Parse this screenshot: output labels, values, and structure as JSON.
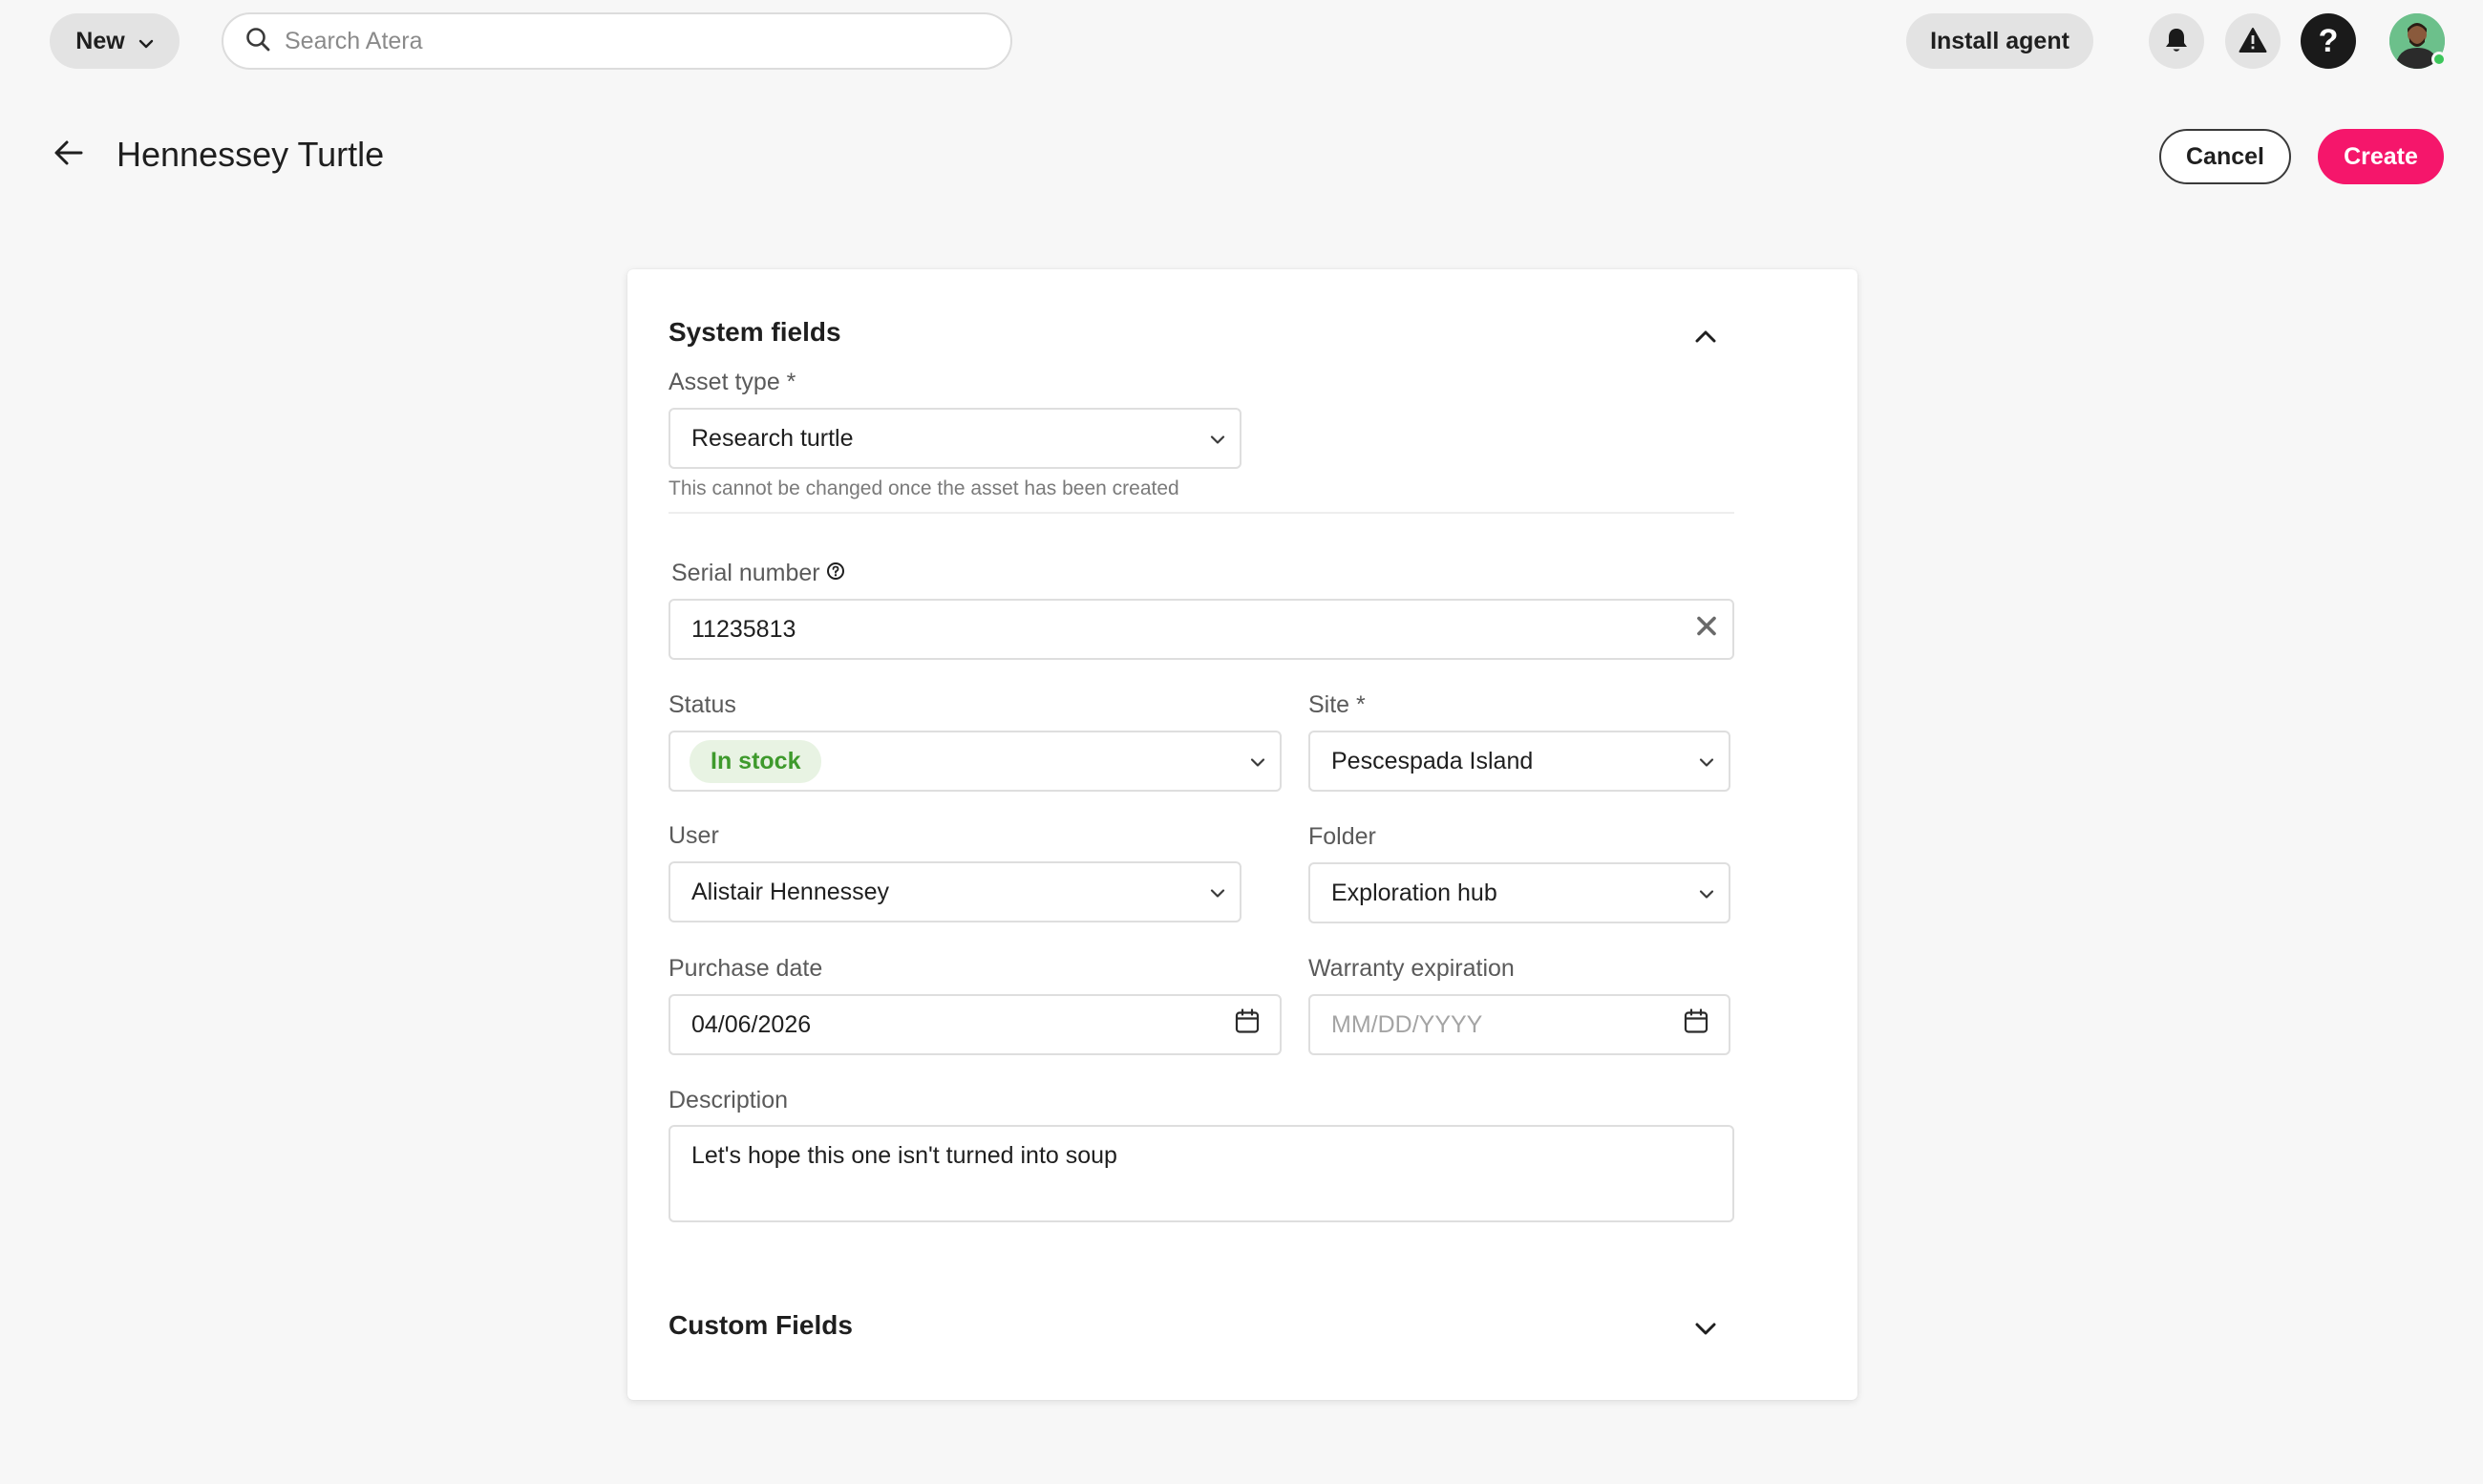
{
  "topbar": {
    "new_label": "New",
    "search_placeholder": "Search Atera",
    "install_agent_label": "Install agent",
    "help_label": "?"
  },
  "header": {
    "title": "Hennessey Turtle",
    "cancel_label": "Cancel",
    "create_label": "Create"
  },
  "colors": {
    "accent": "#f5166b",
    "status_green": "#3e9a2c",
    "status_bg": "#e8f3e3"
  },
  "system_fields": {
    "title": "System fields",
    "asset_type": {
      "label": "Asset type *",
      "value": "Research turtle",
      "hint": "This cannot be changed once the asset has been created"
    },
    "serial_number": {
      "label": "Serial number",
      "value": "11235813"
    },
    "status": {
      "label": "Status",
      "value": "In stock"
    },
    "site": {
      "label": "Site *",
      "value": "Pescespada Island"
    },
    "user": {
      "label": "User",
      "value": "Alistair Hennessey"
    },
    "folder": {
      "label": "Folder",
      "value": "Exploration hub"
    },
    "purchase_date": {
      "label": "Purchase date",
      "value": "04/06/2026"
    },
    "warranty_expiration": {
      "label": "Warranty expiration",
      "placeholder": "MM/DD/YYYY"
    },
    "description": {
      "label": "Description",
      "value": "Let's hope this one isn't turned into soup"
    }
  },
  "custom_fields": {
    "title": "Custom Fields"
  },
  "icons": {
    "new_chevron": "chevron-down-icon",
    "search": "search-icon",
    "bell": "bell-icon",
    "warning": "warning-icon",
    "back": "arrow-left-icon",
    "collapse": "chevron-up-icon",
    "expand": "chevron-down-icon",
    "clear": "close-icon",
    "calendar": "calendar-icon",
    "info": "help-circle-icon"
  }
}
